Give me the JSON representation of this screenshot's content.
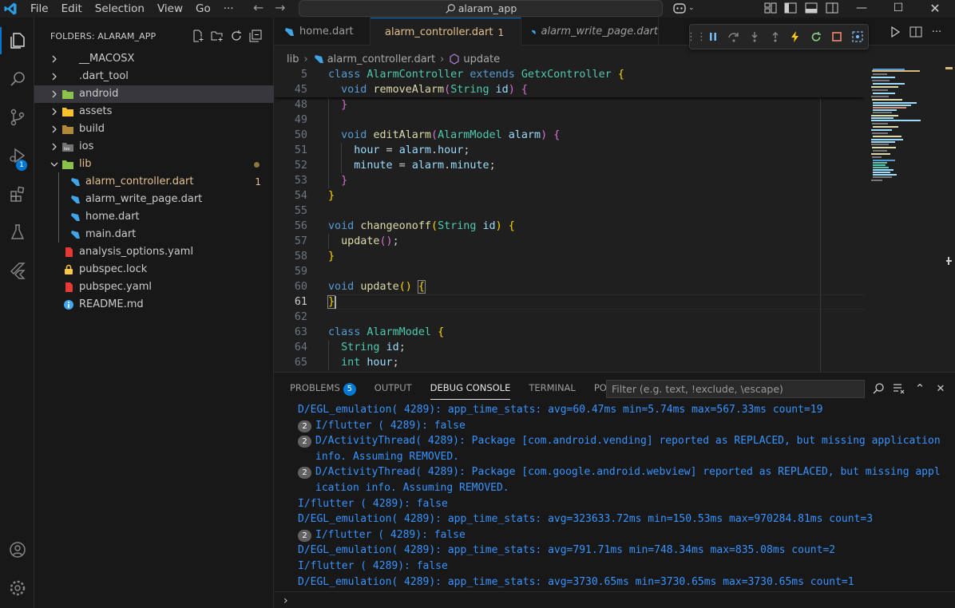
{
  "menu": [
    "File",
    "Edit",
    "Selection",
    "View",
    "Go",
    "···"
  ],
  "search": {
    "text": "alaram_app"
  },
  "explorer": {
    "header": "FOLDERS: ALARAM_APP",
    "items": [
      {
        "label": "__MACOSX",
        "type": "folder",
        "depth": 0,
        "open": false
      },
      {
        "label": ".dart_tool",
        "type": "folder",
        "depth": 0,
        "open": false
      },
      {
        "label": "android",
        "type": "folder-android",
        "depth": 0,
        "open": false,
        "selected": true
      },
      {
        "label": "assets",
        "type": "folder",
        "depth": 0,
        "open": false
      },
      {
        "label": "build",
        "type": "folder",
        "depth": 0,
        "open": false
      },
      {
        "label": "ios",
        "type": "folder-ios",
        "depth": 0,
        "open": false
      },
      {
        "label": "lib",
        "type": "folder-lib",
        "depth": 0,
        "open": true,
        "modified": true
      },
      {
        "label": "alarm_controller.dart",
        "type": "dart",
        "depth": 1,
        "modified": true,
        "badge": "1"
      },
      {
        "label": "alarm_write_page.dart",
        "type": "dart",
        "depth": 1
      },
      {
        "label": "home.dart",
        "type": "dart",
        "depth": 1
      },
      {
        "label": "main.dart",
        "type": "dart",
        "depth": 1
      },
      {
        "label": "analysis_options.yaml",
        "type": "yaml",
        "depth": 0
      },
      {
        "label": "pubspec.lock",
        "type": "lock",
        "depth": 0
      },
      {
        "label": "pubspec.yaml",
        "type": "yaml",
        "depth": 0
      },
      {
        "label": "README.md",
        "type": "info",
        "depth": 0
      }
    ]
  },
  "activity": {
    "debug_badge": "1"
  },
  "tabs": [
    {
      "label": "home.dart",
      "active": false
    },
    {
      "label": "alarm_controller.dart",
      "active": true,
      "problems": "1"
    },
    {
      "label": "alarm_write_page.dart",
      "active": false
    }
  ],
  "breadcrumb": [
    "lib",
    "alarm_controller.dart",
    "update"
  ],
  "code": [
    {
      "n": "5",
      "html": "<span class='k'>class</span> <span class='t'>AlarmController</span> <span class='k'>extends</span> <span class='t'>GetxController</span> <span class='b1'>{</span>",
      "sticky": true
    },
    {
      "n": "45",
      "html": "  <span class='k'>void</span> <span class='f'>removeAlarm</span><span class='b2'>(</span><span class='t'>String</span> <span class='v'>id</span><span class='b2'>)</span> <span class='b2'>{</span>",
      "sticky": true
    },
    {
      "n": "48",
      "html": "  <span class='b2'>}</span>"
    },
    {
      "n": "49",
      "html": ""
    },
    {
      "n": "50",
      "html": "  <span class='k'>void</span> <span class='f'>editAlarm</span><span class='b2'>(</span><span class='t'>AlarmModel</span> <span class='v'>alarm</span><span class='b2'>)</span> <span class='b2'>{</span>"
    },
    {
      "n": "51",
      "html": "    <span class='v'>hour</span> = <span class='v'>alarm</span>.<span class='v'>hour</span>;"
    },
    {
      "n": "52",
      "html": "    <span class='v'>minute</span> = <span class='v'>alarm</span>.<span class='v'>minute</span>;"
    },
    {
      "n": "53",
      "html": "  <span class='b2'>}</span>"
    },
    {
      "n": "54",
      "html": "<span class='b1'>}</span>"
    },
    {
      "n": "55",
      "html": ""
    },
    {
      "n": "56",
      "html": "<span class='k'>void</span> <span class='f'>changeonoff</span><span class='b1'>(</span><span class='t'>String</span> <span class='v'>id</span><span class='b1'>)</span> <span class='b1'>{</span>"
    },
    {
      "n": "57",
      "html": "  <span class='f'>update</span><span class='b2'>()</span>;"
    },
    {
      "n": "58",
      "html": "<span class='b1'>}</span>"
    },
    {
      "n": "59",
      "html": ""
    },
    {
      "n": "60",
      "html": "<span class='k'>void</span> <span class='f'>update</span><span class='b1'>()</span> <span class='b1' style='outline:1px solid #888'>{</span>"
    },
    {
      "n": "61",
      "html": "<span class='b1' style='outline:1px solid #888'>}</span>",
      "current": true
    },
    {
      "n": "62",
      "html": ""
    },
    {
      "n": "63",
      "html": "<span class='k'>class</span> <span class='t'>AlarmModel</span> <span class='b1'>{</span>"
    },
    {
      "n": "64",
      "html": "  <span class='t'>String</span> <span class='v'>id</span>;"
    },
    {
      "n": "65",
      "html": "  <span class='t'>int</span> <span class='v'>hour</span>;"
    }
  ],
  "panel": {
    "tabs": [
      {
        "label": "PROBLEMS",
        "badge": "5"
      },
      {
        "label": "OUTPUT"
      },
      {
        "label": "DEBUG CONSOLE",
        "active": true
      },
      {
        "label": "TERMINAL"
      },
      {
        "label": "PORTS"
      }
    ],
    "filter_placeholder": "Filter (e.g. text, !exclude, \\escape)",
    "prompt": "›"
  },
  "console": [
    {
      "text": "D/EGL_emulation( 4289): app_time_stats: avg=60.47ms min=5.74ms max=567.33ms count=19",
      "count": null
    },
    {
      "text": "I/flutter ( 4289): false",
      "count": "2"
    },
    {
      "text": "D/ActivityThread( 4289): Package [com.android.vending] reported as REPLACED, but missing application info. Assuming REMOVED.",
      "count": "2",
      "wrap": true
    },
    {
      "text": "D/ActivityThread( 4289): Package [com.google.android.webview] reported as REPLACED, but missing application info. Assuming REMOVED.",
      "count": "2",
      "wrap": true
    },
    {
      "text": "I/flutter ( 4289): false",
      "count": null
    },
    {
      "text": "D/EGL_emulation( 4289): app_time_stats: avg=323633.72ms min=150.53ms max=970284.81ms count=3",
      "count": null
    },
    {
      "text": "I/flutter ( 4289): false",
      "count": "2"
    },
    {
      "text": "D/EGL_emulation( 4289): app_time_stats: avg=791.71ms min=748.34ms max=835.08ms count=2",
      "count": null
    },
    {
      "text": "I/flutter ( 4289): false",
      "count": null
    },
    {
      "text": "D/EGL_emulation( 4289): app_time_stats: avg=3730.65ms min=3730.65ms max=3730.65ms count=1",
      "count": null
    }
  ],
  "colors": {
    "accent": "#0078d4",
    "modified": "#e2c08d",
    "console_text": "#3794ff"
  }
}
